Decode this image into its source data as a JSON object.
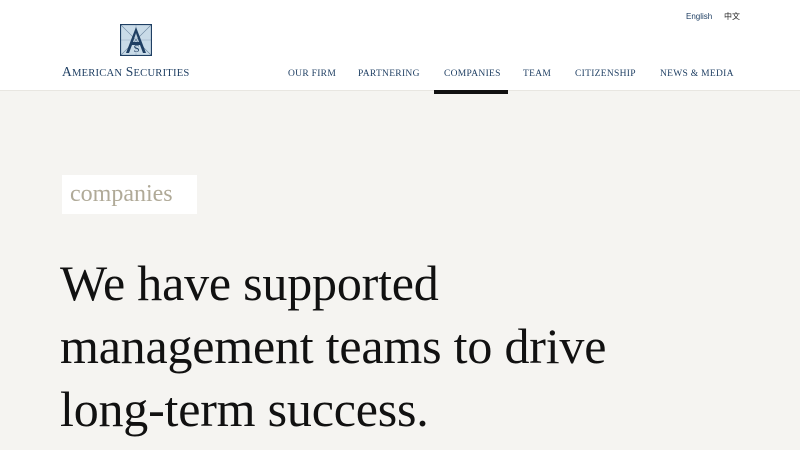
{
  "language": {
    "english": "English",
    "chinese": "中文"
  },
  "logo": {
    "mark_letters": "AS",
    "name_first_initial": "A",
    "name_first_rest": "MERICAN",
    "name_second_initial": "S",
    "name_second_rest": "ECURITIES",
    "colors": {
      "navy": "#1f3f63",
      "light_blue": "#c9dbe8"
    }
  },
  "nav": {
    "items": [
      {
        "label": "OUR FIRM"
      },
      {
        "label": "PARTNERING"
      },
      {
        "label": "COMPANIES",
        "active": true
      },
      {
        "label": "TEAM"
      },
      {
        "label": "CITIZENSHIP"
      },
      {
        "label": "NEWS & MEDIA"
      }
    ],
    "active_indicator_color": "#111111"
  },
  "hero": {
    "section_label": "companies",
    "headline_line1": "We have supported",
    "headline_line2": "management teams to drive",
    "headline_line3": "long-term success."
  },
  "colors": {
    "page_background": "#f5f4f1",
    "header_background": "#ffffff",
    "label_text": "#b0aa98",
    "headline_text": "#111111"
  }
}
